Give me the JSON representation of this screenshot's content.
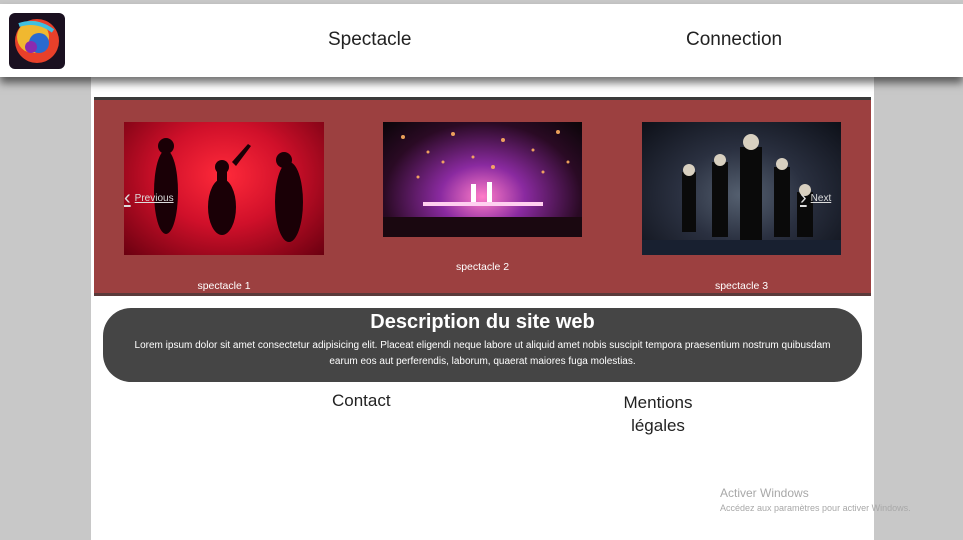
{
  "header": {
    "nav": [
      "Spectacle",
      "Connection"
    ]
  },
  "carousel": {
    "prev_label": "Previous",
    "next_label": "Next",
    "slides": [
      {
        "caption": "spectacle 1"
      },
      {
        "caption": "spectacle 2"
      },
      {
        "caption": "spectacle 3"
      }
    ]
  },
  "description": {
    "title": "Description du site web",
    "text": "Lorem ipsum dolor sit amet consectetur adipisicing elit. Placeat eligendi neque labore ut aliquid amet nobis suscipit tempora praesentium nostrum quibusdam earum eos aut perferendis, laborum, quaerat maiores fuga molestias."
  },
  "footer": {
    "contact": "Contact",
    "mentions": "Mentions légales"
  },
  "windows_watermark": {
    "line1": "Activer Windows",
    "line2": "Accédez aux paramètres pour activer Windows."
  },
  "colors": {
    "carousel_bg": "#9c4040",
    "description_bg": "#454545",
    "page_bg": "#c8c8c8"
  }
}
